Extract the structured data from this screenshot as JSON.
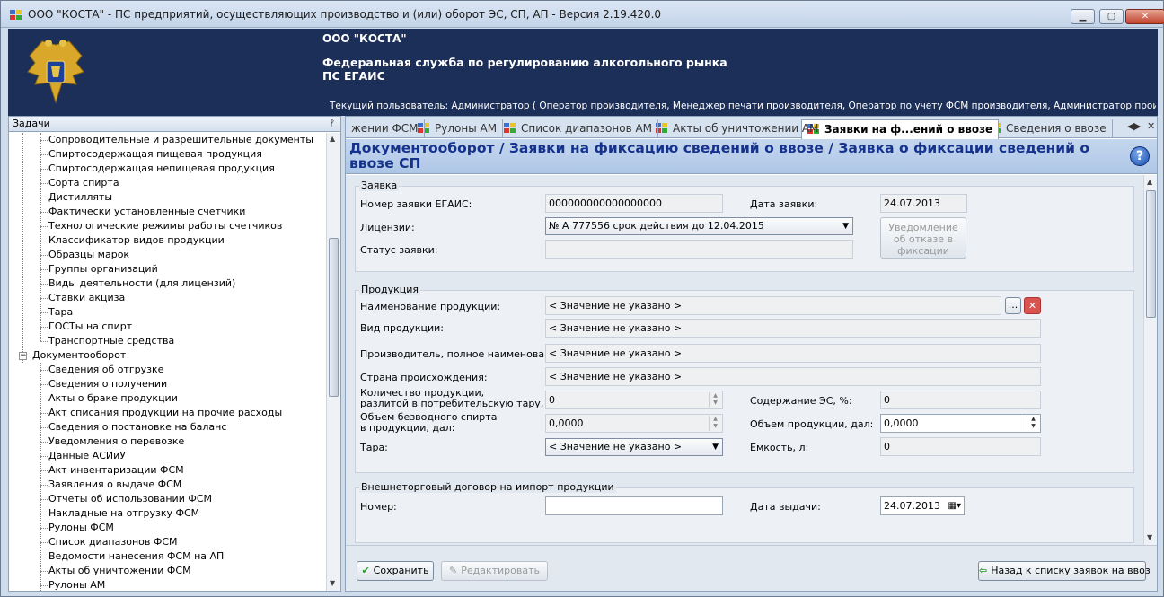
{
  "window": {
    "title": "ООО \"КОСТА\" - ПС предприятий, осуществляющих производство и (или) оборот ЭС, СП, АП - Версия 2.19.420.0",
    "minimize": "▁",
    "maximize": "▢",
    "close": "✕"
  },
  "header": {
    "org": "ООО \"КОСТА\"",
    "service_line1": "Федеральная служба по регулированию алкогольного рынка",
    "service_line2": "ПС ЕГАИС",
    "user": "Текущий пользователь: Администратор ( Оператор производителя, Менеджер печати производителя, Оператор по учету ФСМ производителя, Администратор производителя, О..."
  },
  "left_panel": {
    "title": "Задачи",
    "pin": "ᚹ",
    "tree_items_level2_a": [
      "Сопроводительные и разрешительные документы",
      "Спиртосодержащая пищевая продукция",
      "Спиртосодержащая непищевая продукция",
      "Сорта спирта",
      "Дистилляты",
      "Фактически установленные счетчики",
      "Технологические режимы работы счетчиков",
      "Классификатор видов продукции",
      "Образцы марок",
      "Группы организаций",
      "Виды деятельности (для лицензий)",
      "Ставки акциза",
      "Тара",
      "ГОСТы на спирт",
      "Транспортные средства"
    ],
    "tree_group": "Документооборот",
    "tree_items_level2_b": [
      "Сведения об отгрузке",
      "Сведения о получении",
      "Акты о браке продукции",
      "Акт списания продукции на прочие расходы",
      "Сведения о постановке на баланс",
      "Уведомления о перевозке",
      "Данные АСИиУ",
      "Акт инвентаризации ФСМ",
      "Заявления о выдаче ФСМ",
      "Отчеты об использовании ФСМ",
      "Накладные на отгрузку ФСМ",
      "Рулоны ФСМ",
      "Список диапазонов ФСМ",
      "Ведомости нанесения ФСМ на АП",
      "Акты об уничтожении ФСМ",
      "Рулоны АМ"
    ]
  },
  "tabs": [
    {
      "label": "жении ФСМ",
      "active": false
    },
    {
      "label": "Рулоны АМ",
      "active": false
    },
    {
      "label": "Список диапазонов АМ",
      "active": false
    },
    {
      "label": "Акты об уничтожении АМ",
      "active": false
    },
    {
      "label": "Заявки на ф...ений о ввозе",
      "active": true
    },
    {
      "label": "Сведения о ввозе",
      "active": false
    }
  ],
  "tab_nav": {
    "left": "◀",
    "right": "▶",
    "close": "✕"
  },
  "breadcrumb": "Документооборот / Заявки на фиксацию сведений о ввозе / Заявка о фиксации сведений о ввозе СП",
  "help": "?",
  "form": {
    "group_request": "Заявка",
    "request_number_label": "Номер заявки ЕГАИС:",
    "request_number_value": "000000000000000000",
    "request_date_label": "Дата заявки:",
    "request_date_value": "24.07.2013",
    "licenses_label": "Лицензии:",
    "licenses_value": "№ А 777556 срок действия до 12.04.2015",
    "status_label": "Статус заявки:",
    "status_value": "",
    "refusal_button": "Уведомление об отказе в фиксации",
    "group_product": "Продукция",
    "product_name_label": "Наименование продукции:",
    "product_name_value": "< Значение не указано >",
    "browse_button": "...",
    "product_type_label": "Вид продукции:",
    "product_type_value": "< Значение не указано >",
    "producer_label": "Производитель, полное наименование:",
    "producer_value": "< Значение не указано >",
    "country_label": "Страна происхождения:",
    "country_value": "< Значение не указано >",
    "quantity_label_1": "Количество продукции,",
    "quantity_label_2": "разлитой в потребительскую тару, шт:",
    "quantity_value": "0",
    "es_content_label": "Содержание ЭС, %:",
    "es_content_value": "0",
    "anhydrous_label_1": "Объем безводного спирта",
    "anhydrous_label_2": "в продукции, дал:",
    "anhydrous_value": "0,0000",
    "volume_label": "Объем продукции, дал:",
    "volume_value": "0,0000",
    "container_label": "Тара:",
    "container_value": "< Значение не указано >",
    "capacity_label": "Емкость, л:",
    "capacity_value": "0",
    "group_contract": "Внешнеторговый договор на импорт продукции",
    "contract_number_label": "Номер:",
    "contract_number_value": "",
    "issue_date_label": "Дата выдачи:",
    "issue_date_value": "24.07.2013"
  },
  "footer": {
    "save": "Сохранить",
    "edit": "Редактировать",
    "back": "Назад к списку заявок на ввоз"
  }
}
